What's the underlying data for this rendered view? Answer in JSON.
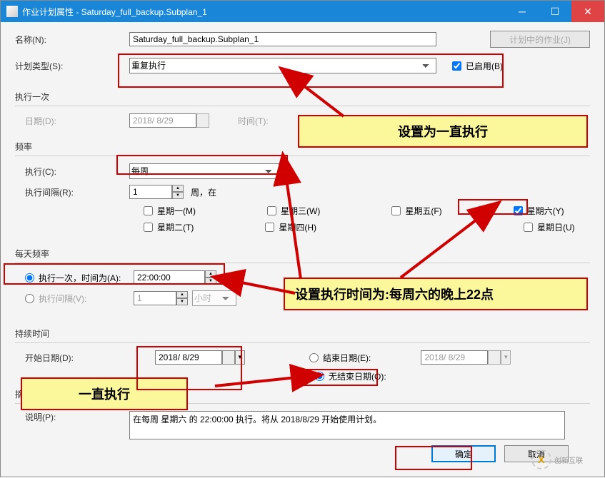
{
  "window": {
    "title": "作业计划属性 - Saturday_full_backup.Subplan_1"
  },
  "fields": {
    "name_label": "名称(N):",
    "name_value": "Saturday_full_backup.Subplan_1",
    "jobs_in_schedule_btn": "计划中的作业(J)",
    "schedule_type_label": "计划类型(S):",
    "schedule_type_value": "重复执行",
    "enabled_label": "已启用(B)",
    "onetime_section": "执行一次",
    "onetime_date_label": "日期(D):",
    "onetime_date_value": "2018/ 8/29",
    "onetime_time_label": "时间(T):",
    "freq_section": "频率",
    "occurs_label": "执行(C):",
    "occurs_value": "每周",
    "recur_label": "执行间隔(R):",
    "recur_value": "1",
    "recur_unit": "周，在",
    "days": {
      "mon": "星期一(M)",
      "tue": "星期二(T)",
      "wed": "星期三(W)",
      "thu": "星期四(H)",
      "fri": "星期五(F)",
      "sat": "星期六(Y)",
      "sun": "星期日(U)"
    },
    "daily_section": "每天频率",
    "occurs_once_label": "执行一次，时间为(A):",
    "occurs_once_value": "22:00:00",
    "occurs_every_label": "执行间隔(V):",
    "occurs_every_value": "1",
    "occurs_every_unit": "小时",
    "duration_section": "持续时间",
    "start_date_label": "开始日期(D):",
    "start_date_value": "2018/ 8/29",
    "end_date_label": "结束日期(E):",
    "end_date_value": "2018/ 8/29",
    "no_end_label": "无结束日期(O):",
    "summary_section": "摘要",
    "desc_label": "说明(P):",
    "desc_value": "在每周 星期六 的 22:00:00 执行。将从 2018/8/29 开始使用计划。",
    "ok_btn": "确定",
    "cancel_btn": "取消"
  },
  "callouts": {
    "c1": "设置为一直执行",
    "c2": "设置执行时间为:每周六的晚上22点",
    "c3": "一直执行"
  },
  "watermark": "创新互联"
}
